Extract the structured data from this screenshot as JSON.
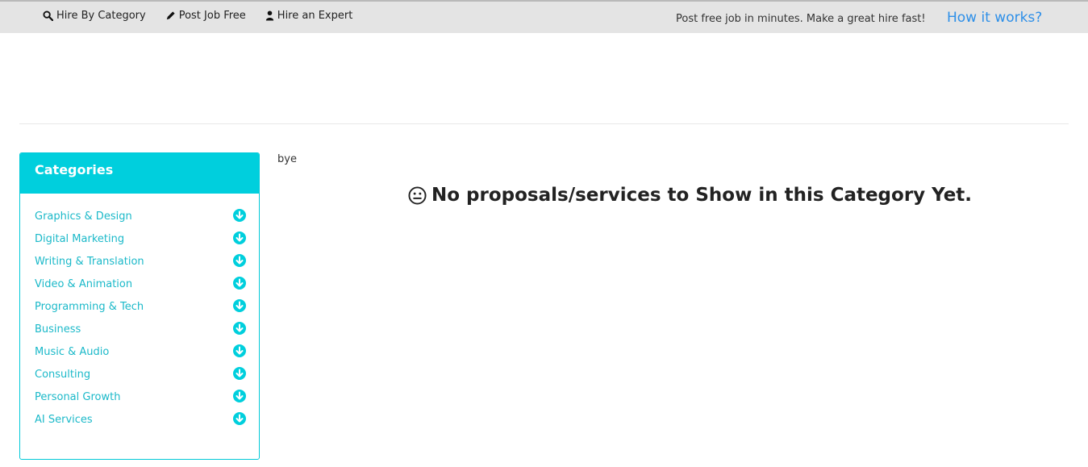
{
  "topbar": {
    "nav": [
      {
        "label": "Hire By Category",
        "icon": "search-icon"
      },
      {
        "label": "Post Job Free",
        "icon": "pencil-icon"
      },
      {
        "label": "Hire an Expert",
        "icon": "user-icon"
      }
    ],
    "tagline": "Post free job in minutes. Make a great hire fast!",
    "how_link": "How it works?"
  },
  "sidebar": {
    "title": "Categories",
    "items": [
      {
        "label": "Graphics & Design"
      },
      {
        "label": "Digital Marketing"
      },
      {
        "label": "Writing & Translation"
      },
      {
        "label": "Video & Animation"
      },
      {
        "label": "Programming & Tech"
      },
      {
        "label": "Business"
      },
      {
        "label": "Music & Audio"
      },
      {
        "label": "Consulting"
      },
      {
        "label": "Personal Growth"
      },
      {
        "label": "AI Services"
      }
    ],
    "item_icon": "arrow-circle-down-icon"
  },
  "main": {
    "note": "bye",
    "empty_message": "No proposals/services to Show in this Category Yet.",
    "empty_icon": "neutral-face-icon"
  },
  "colors": {
    "accent": "#00cfdd",
    "link_blue": "#2d8fe8",
    "topbar_bg": "#e4e4e4"
  }
}
